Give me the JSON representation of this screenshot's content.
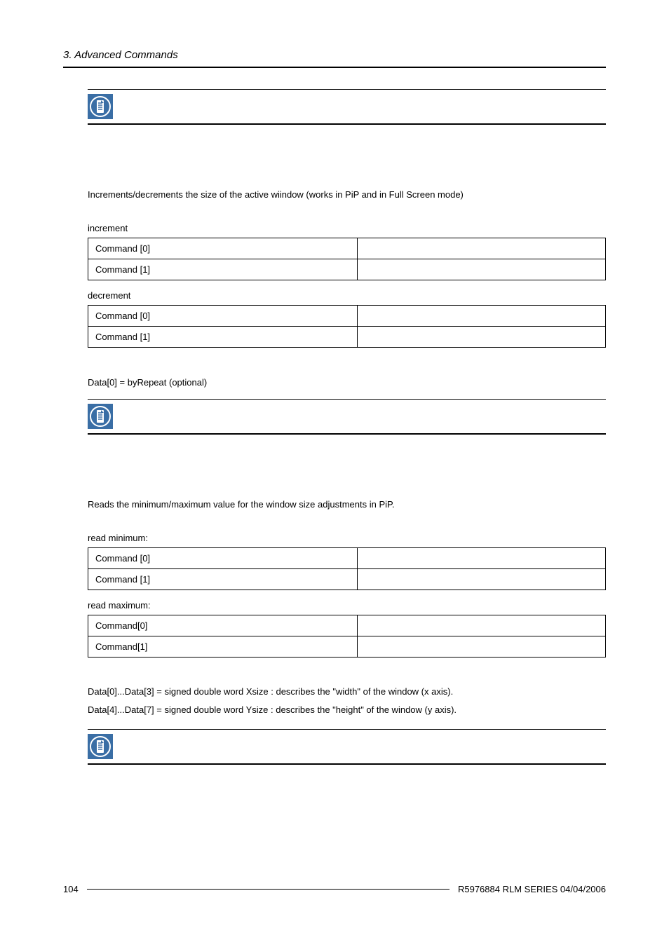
{
  "header": {
    "title": "3.  Advanced Commands"
  },
  "section1": {
    "description": "Increments/decrements the size of the active wiindow (works in PiP and in Full Screen mode)",
    "incrementLabel": "increment",
    "table1": {
      "row1c1": "Command [0]",
      "row1c2": "",
      "row2c1": "Command [1]",
      "row2c2": ""
    },
    "decrementLabel": "decrement",
    "table2": {
      "row1c1": "Command [0]",
      "row1c2": "",
      "row2c1": "Command [1]",
      "row2c2": ""
    },
    "dataNote": "Data[0] = byRepeat (optional)"
  },
  "section2": {
    "description": "Reads the minimum/maximum value for the window size adjustments in PiP.",
    "readMinLabel": "read minimum:",
    "table1": {
      "row1c1": "Command [0]",
      "row1c2": "",
      "row2c1": "Command [1]",
      "row2c2": ""
    },
    "readMaxLabel": "read maximum:",
    "table2": {
      "row1c1": "Command[0]",
      "row1c2": "",
      "row2c1": "Command[1]",
      "row2c2": ""
    },
    "dataLine1": "Data[0]...Data[3] = signed double word Xsize :  describes the \"width\" of the window (x axis).",
    "dataLine2": "Data[4]...Data[7] = signed double word Ysize :  describes the \"height\" of the window (y axis)."
  },
  "footer": {
    "pageNum": "104",
    "right": "R5976884  RLM SERIES  04/04/2006"
  }
}
